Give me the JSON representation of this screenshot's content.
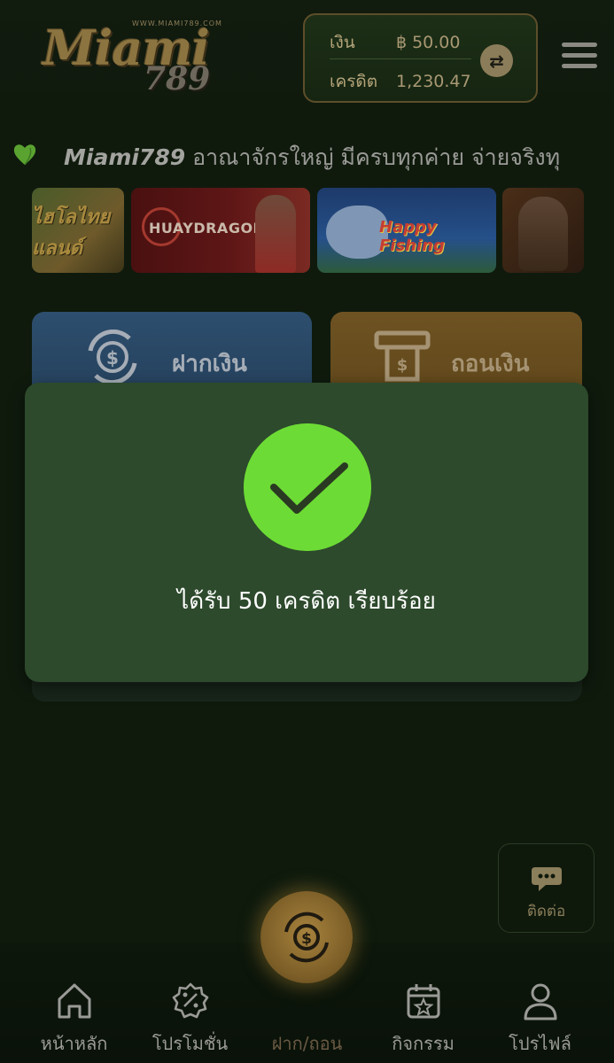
{
  "header": {
    "logo": {
      "url_text": "WWW.MIAMI789.COM",
      "main": "Miami",
      "number": "789"
    },
    "wallet": {
      "balance_label": "เงิน",
      "currency_symbol": "฿",
      "balance_value": "50.00",
      "credit_label": "เครดิต",
      "credit_value": "1,230.47",
      "swap_icon": "swap-arrows-icon"
    },
    "menu_icon": "hamburger-menu-icon"
  },
  "marquee": {
    "icon": "green-heart-icon",
    "brand": "Miami789",
    "text": " อาณาจักรใหญ่ มีครบทุกค่าย จ่ายจริงทุ"
  },
  "banners": [
    {
      "title": "ไฮโลไทยแลนด์"
    },
    {
      "title": "HUAYDRAGON"
    },
    {
      "title": "Happy Fishing"
    },
    {
      "title": ""
    }
  ],
  "actions": {
    "deposit": {
      "label": "ฝากเงิน",
      "icon": "money-cycle-icon"
    },
    "withdraw": {
      "label": "ถอนเงิน",
      "icon": "atm-icon"
    }
  },
  "modal": {
    "icon": "check-icon",
    "message": "ได้รับ 50 เครดิต เรียบร้อย",
    "accent_color": "#6ddb35"
  },
  "contact": {
    "label": "ติดต่อ",
    "icon": "chat-support-icon"
  },
  "bottom_nav": {
    "items": [
      {
        "label": "หน้าหลัก",
        "icon": "home-icon",
        "active": false
      },
      {
        "label": "โปรโมชั่น",
        "icon": "promotion-badge-icon",
        "active": false
      },
      {
        "label": "ฝาก/ถอน",
        "icon": "money-cycle-icon",
        "active": true
      },
      {
        "label": "กิจกรรม",
        "icon": "calendar-star-icon",
        "active": false
      },
      {
        "label": "โปรไฟล์",
        "icon": "user-icon",
        "active": false
      }
    ]
  }
}
